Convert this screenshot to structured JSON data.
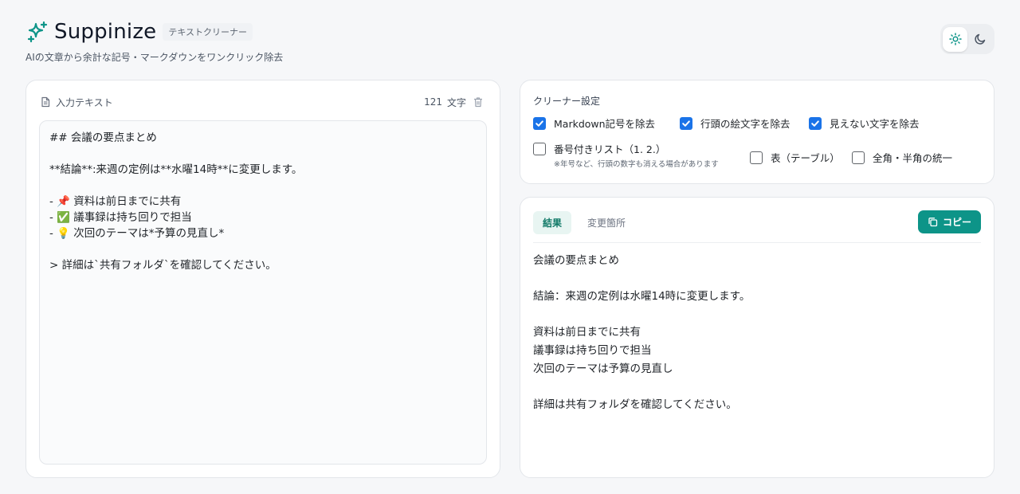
{
  "header": {
    "app_name": "Suppinize",
    "tag": "テキストクリーナー",
    "subtitle": "AIの文章から余計な記号・マークダウンをワンクリック除去"
  },
  "theme_toggle": {
    "light_icon": "sun-icon",
    "dark_icon": "moon-icon",
    "selected": "light"
  },
  "input_panel": {
    "label": "入力テキスト",
    "char_count": "121",
    "char_unit": "文字",
    "text": "## 会議の要点まとめ\n\n**結論**:来週の定例は**水曜14時**に変更します。\n\n- 📌 資料は前日までに共有\n- ✅ 議事録は持ち回りで担当\n- 💡 次回のテーマは*予算の見直し*\n\n> 詳細は`共有フォルダ`を確認してください。"
  },
  "settings": {
    "title": "クリーナー設定",
    "options": [
      {
        "label": "Markdown記号を除去",
        "checked": true
      },
      {
        "label": "行頭の絵文字を除去",
        "checked": true
      },
      {
        "label": "見えない文字を除去",
        "checked": true
      },
      {
        "label": "番号付きリスト（1. 2.）",
        "checked": false,
        "note": "※年号など、行頭の数字も消える場合があります"
      },
      {
        "label": "表（テーブル）",
        "checked": false
      },
      {
        "label": "全角・半角の統一",
        "checked": false
      }
    ]
  },
  "result_panel": {
    "tabs": [
      {
        "label": "結果",
        "active": true
      },
      {
        "label": "変更箇所",
        "active": false
      }
    ],
    "copy_label": "コピー",
    "text": "会議の要点まとめ\n\n結論：来週の定例は水曜14時に変更します。\n\n資料は前日までに共有\n議事録は持ち回りで担当\n次回のテーマは予算の見直し\n\n詳細は共有フォルダを確認してください。"
  },
  "colors": {
    "accent": "#0d9488",
    "checkbox": "#1a73e8",
    "background": "#f6f7f9"
  }
}
